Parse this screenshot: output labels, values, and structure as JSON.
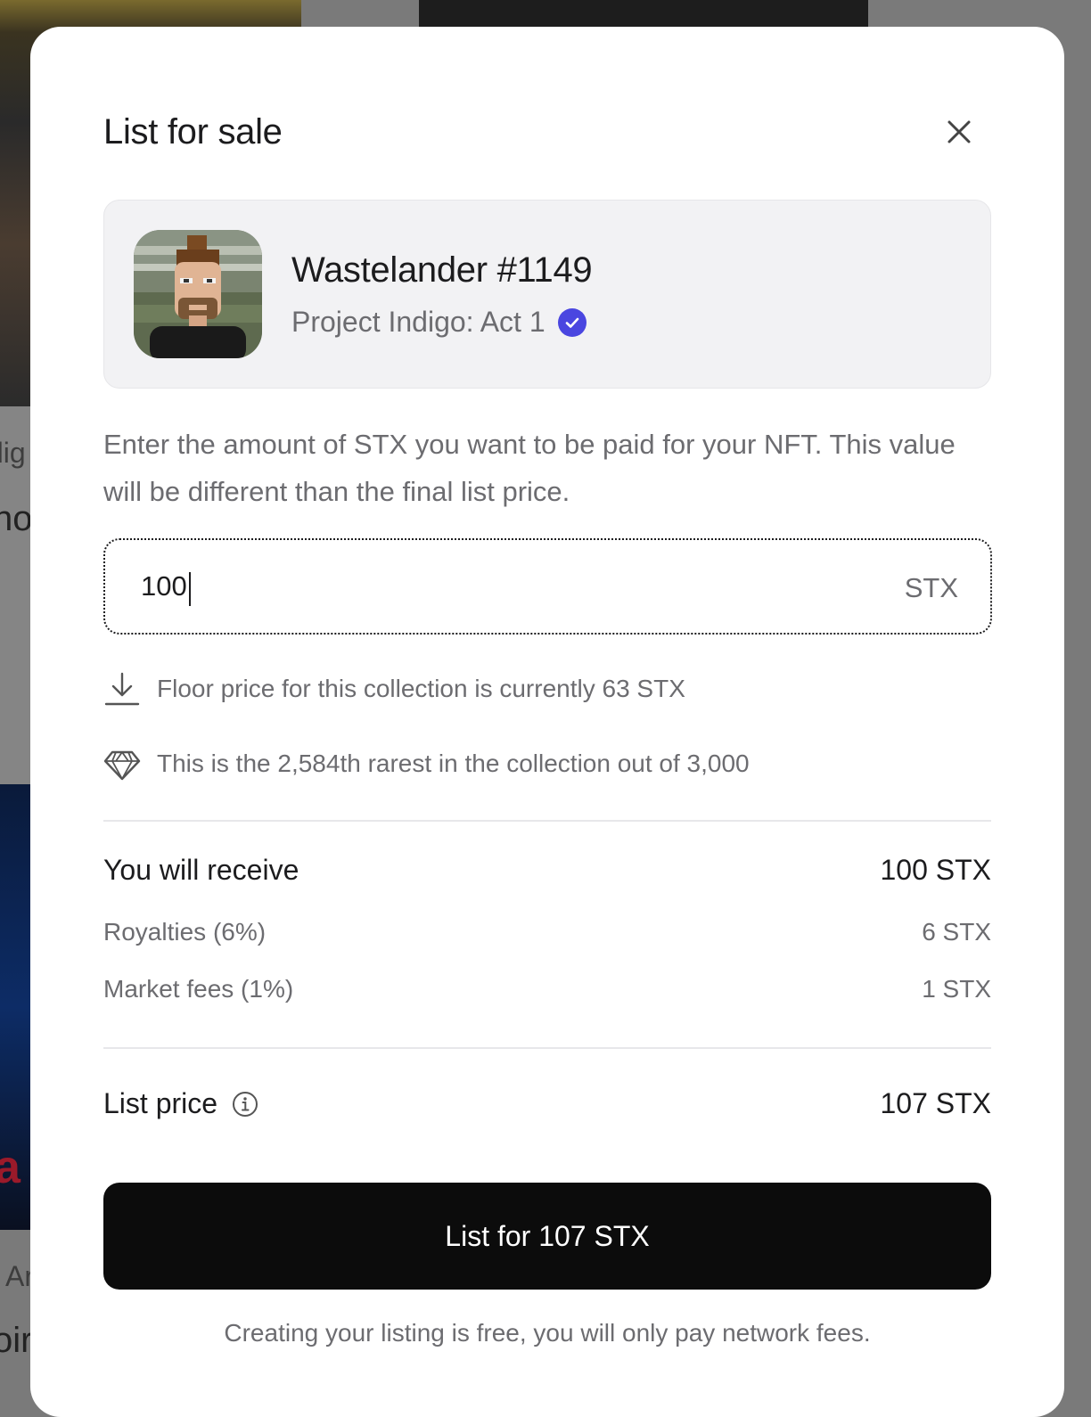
{
  "background": {
    "fragments": [
      "dig",
      "no",
      "Ar",
      "oir",
      "a"
    ]
  },
  "modal": {
    "title": "List for sale",
    "close_icon": "close-icon"
  },
  "nft": {
    "name": "Wastelander #1149",
    "collection": "Project Indigo: Act 1",
    "verified_icon": "verified-check-icon",
    "verified_color": "#4a46e0"
  },
  "instructions": "Enter the amount of STX you want to be paid for your NFT. This value will be different than the final list price.",
  "price_input": {
    "value": "100",
    "suffix": "STX"
  },
  "info": {
    "floor": {
      "icon": "download-arrow-icon",
      "text": "Floor price for this collection is currently 63 STX"
    },
    "rarity": {
      "icon": "diamond-icon",
      "text": "This is the 2,584th rarest in the collection out of 3,000"
    }
  },
  "summary": {
    "receive": {
      "label": "You will receive",
      "value": "100 STX"
    },
    "royalties": {
      "label": "Royalties (6%)",
      "value": "6 STX"
    },
    "market_fees": {
      "label": "Market fees (1%)",
      "value": "1 STX"
    },
    "list_price": {
      "label": "List price",
      "value": "107 STX",
      "icon": "info-icon"
    }
  },
  "cta": {
    "label": "List for 107 STX"
  },
  "footnote": "Creating your listing is free, you will only pay network fees."
}
